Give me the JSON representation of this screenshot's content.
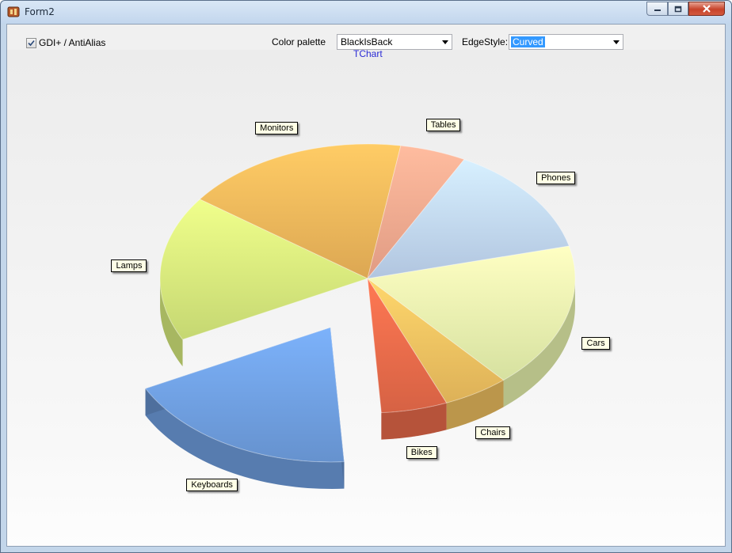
{
  "window": {
    "title": "Form2"
  },
  "toolbar": {
    "antialias_label": "GDI+ / AntiAlias",
    "antialias_checked": true,
    "palette_label": "Color palette",
    "palette_value": "BlackIsBack",
    "edgestyle_label": "EdgeStyle:",
    "edgestyle_value": "Curved"
  },
  "chart_data": {
    "type": "pie",
    "title": "TChart",
    "categories": [
      "Cars",
      "Chairs",
      "Bikes",
      "Keyboards",
      "Lamps",
      "Monitors",
      "Tables",
      "Phones"
    ],
    "values": [
      17,
      5,
      5,
      18,
      17,
      17,
      5,
      13
    ],
    "exploded": [
      "Keyboards"
    ],
    "colors": {
      "Cars": "#e9f5ae",
      "Chairs": "#f0c060",
      "Bikes": "#e96b4a",
      "Keyboards": "#6f9fe0",
      "Lamps": "#d6ea7c",
      "Monitors": "#efb65a",
      "Tables": "#f4a88e",
      "Phones": "#c0d6f2"
    }
  }
}
